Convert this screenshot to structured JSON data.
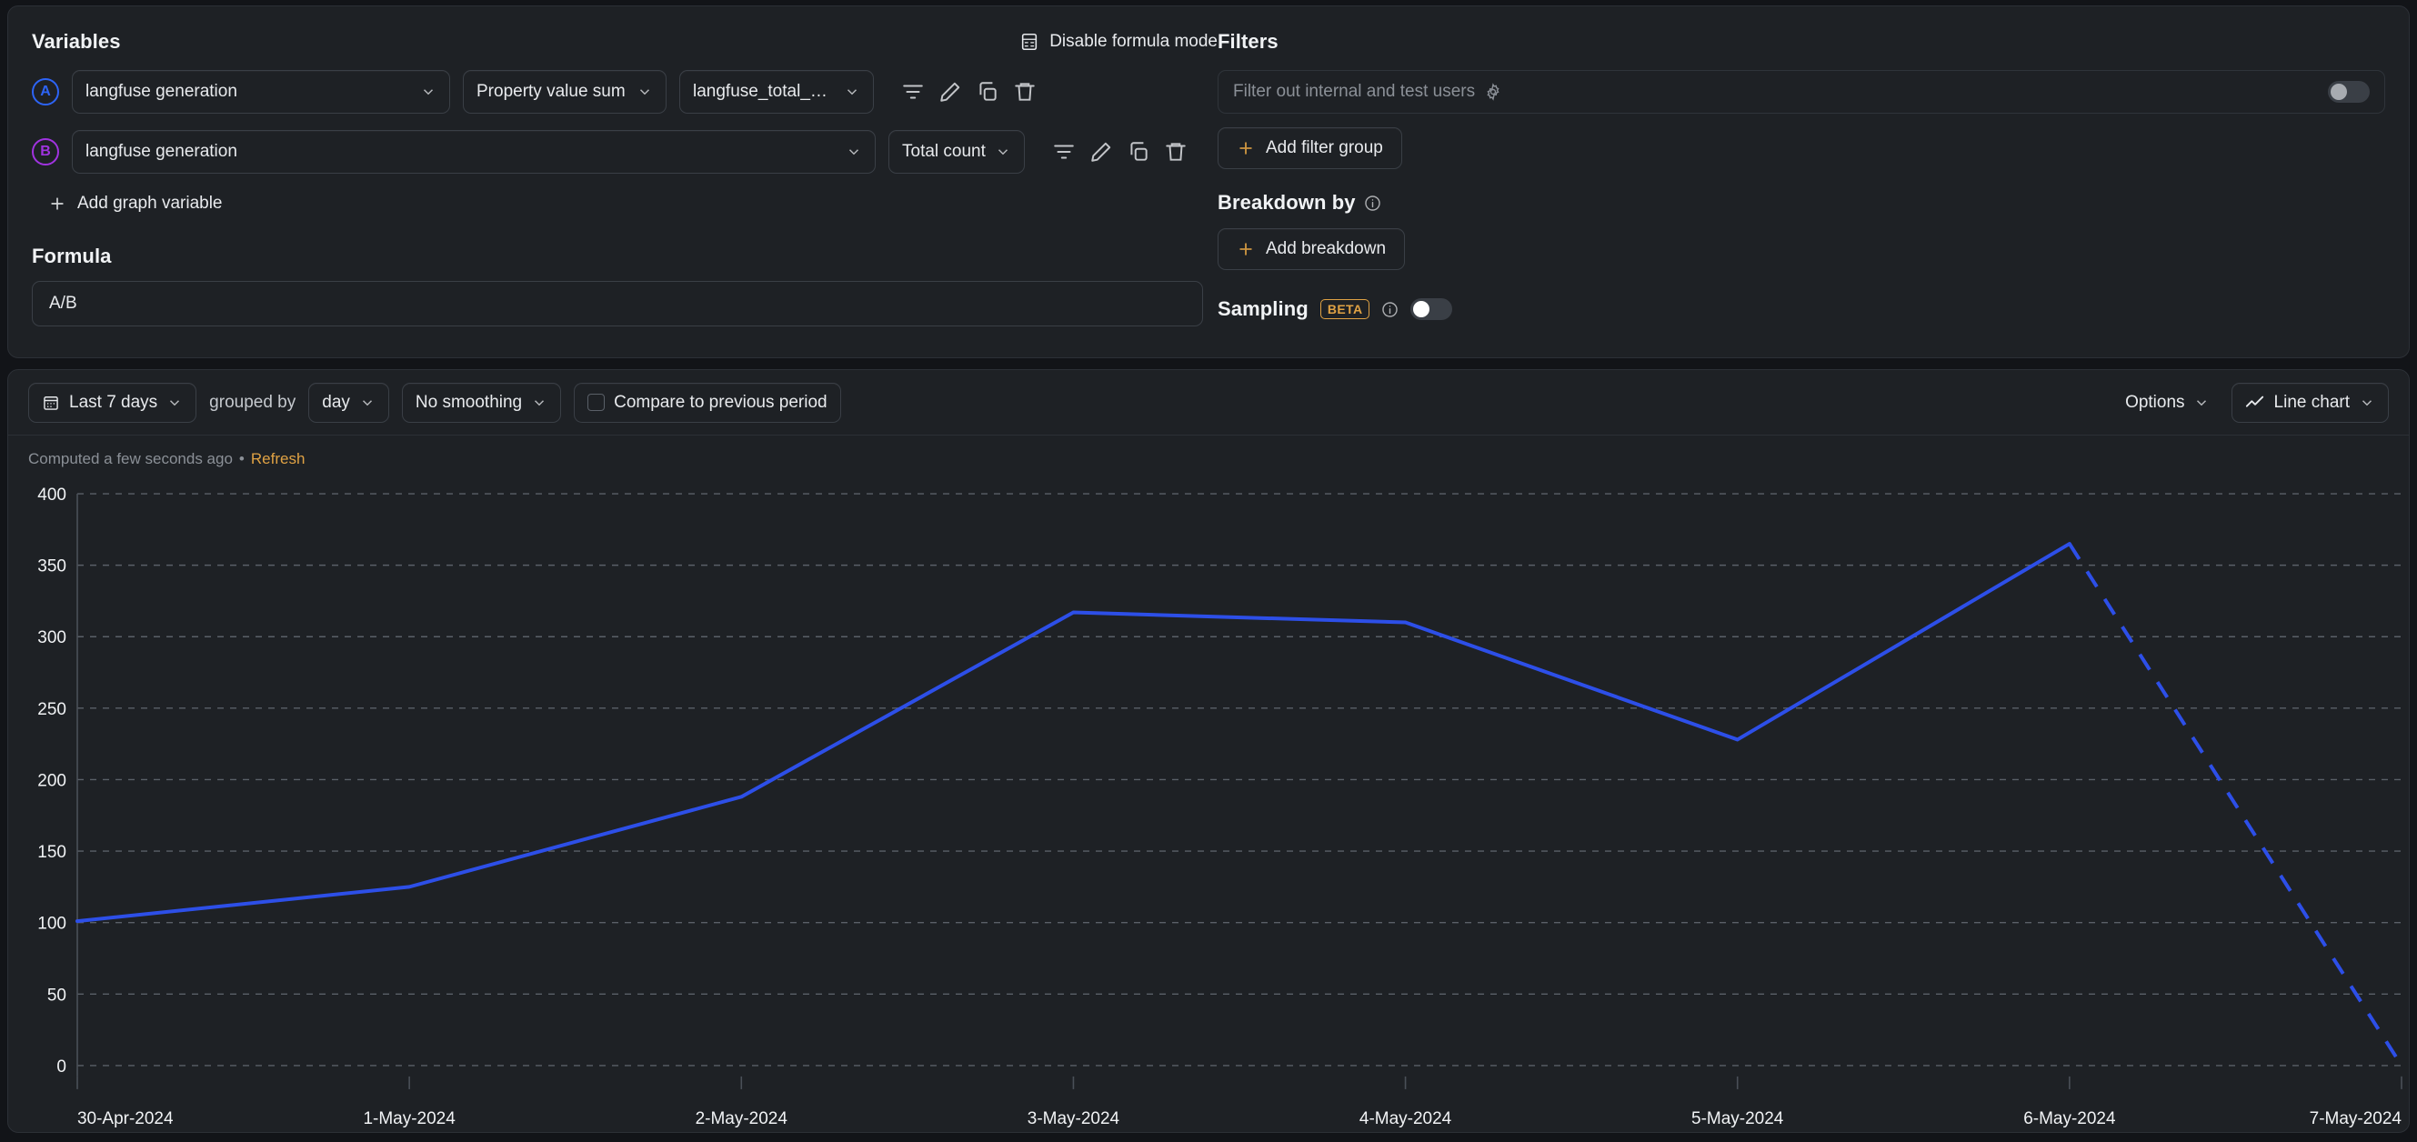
{
  "variables": {
    "title": "Variables",
    "formula_mode_label": "Disable formula mode",
    "formula_mode_icon": "calculator-icon",
    "rows": [
      {
        "badge": "A",
        "badge_color": "#2d64f6",
        "event": "langfuse generation",
        "aggregation": "Property value sum",
        "property": "langfuse_total_units",
        "actions": [
          "filter-icon",
          "pencil-icon",
          "duplicate-icon",
          "trash-icon"
        ]
      },
      {
        "badge": "B",
        "badge_color": "#a033e0",
        "event": "langfuse generation",
        "aggregation": "Total count",
        "property": null,
        "actions": [
          "filter-icon",
          "pencil-icon",
          "duplicate-icon",
          "trash-icon"
        ]
      }
    ],
    "add_variable_label": "Add graph variable"
  },
  "formula": {
    "title": "Formula",
    "value": "A/B"
  },
  "filters": {
    "title": "Filters",
    "internal_users_label": "Filter out internal and test users",
    "internal_users_gear_icon": "gear-icon",
    "internal_users_toggle": "off",
    "add_filter_group_label": "Add filter group"
  },
  "breakdown": {
    "title": "Breakdown by",
    "info_icon": "info-icon",
    "add_breakdown_label": "Add breakdown"
  },
  "sampling": {
    "title": "Sampling",
    "badge": "BETA",
    "info_icon": "info-icon",
    "toggle": "off"
  },
  "toolbar": {
    "date_range": "Last 7 days",
    "date_icon": "calendar-icon",
    "grouped_by_label": "grouped by",
    "group_interval": "day",
    "smoothing": "No smoothing",
    "compare_label": "Compare to previous period",
    "compare_checked": false,
    "options_label": "Options",
    "chart_type": "Line chart",
    "chart_type_icon": "line-chart-icon"
  },
  "status": {
    "computed_text": "Computed a few seconds ago",
    "separator": "•",
    "refresh_label": "Refresh"
  },
  "chart_data": {
    "type": "line",
    "title": "",
    "xlabel": "",
    "ylabel": "",
    "x": [
      "30-Apr-2024",
      "1-May-2024",
      "2-May-2024",
      "3-May-2024",
      "4-May-2024",
      "5-May-2024",
      "6-May-2024",
      "7-May-2024"
    ],
    "y_ticks": [
      0,
      50,
      100,
      150,
      200,
      250,
      300,
      350,
      400
    ],
    "ylim": [
      0,
      400
    ],
    "grid": true,
    "legend": "none",
    "series": [
      {
        "name": "A/B",
        "color": "#2d4fe8",
        "values": [
          101,
          125,
          188,
          317,
          310,
          228,
          365,
          0
        ],
        "dashed_from_index": 6,
        "dashed_note": "last segment rendered dashed (incomplete/projected period)"
      }
    ]
  }
}
